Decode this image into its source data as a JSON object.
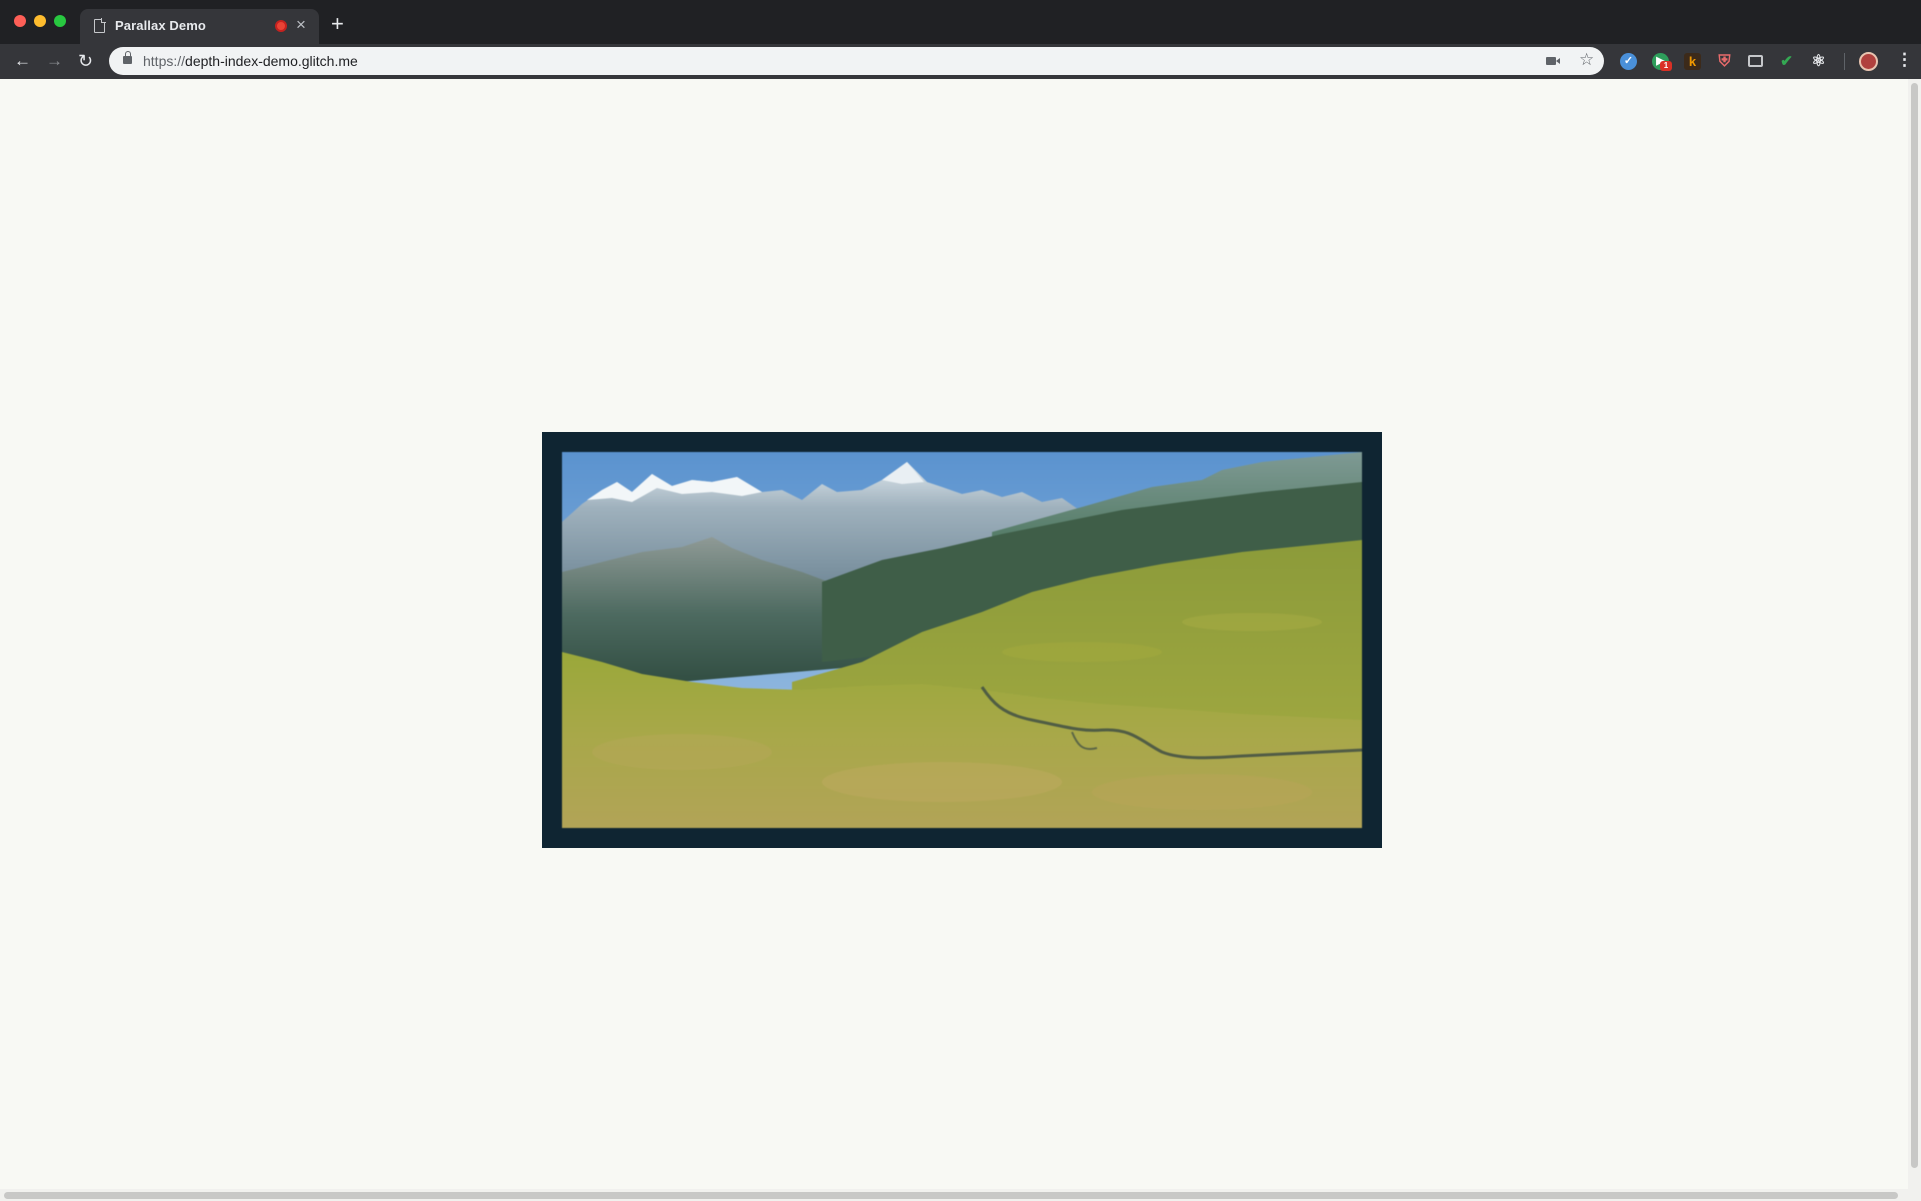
{
  "window": {
    "tab_title": "Parallax Demo",
    "tab_close_glyph": "×",
    "new_tab_glyph": "+"
  },
  "toolbar": {
    "back_glyph": "←",
    "forward_glyph": "→",
    "reload_glyph": "↻",
    "url_scheme": "https://",
    "url_host": "depth-index-demo.glitch.me",
    "star_glyph": "☆",
    "menu_glyph": "⋮",
    "extensions": [
      {
        "name": "extension-1-icon",
        "glyph": "✓"
      },
      {
        "name": "extension-2-icon",
        "glyph": "▶",
        "badge": "1"
      },
      {
        "name": "extension-3-icon",
        "glyph": "k"
      },
      {
        "name": "extension-4-icon",
        "glyph": "⛨"
      },
      {
        "name": "extension-5-icon",
        "glyph": ""
      },
      {
        "name": "extension-6-icon",
        "glyph": "✔"
      },
      {
        "name": "extension-7-icon",
        "glyph": "⚛"
      }
    ]
  },
  "page": {
    "image_alt": "Alpine mountain valley landscape",
    "colors": {
      "background": "#f8f9f4",
      "frame": "#0f2532",
      "sky": "#6fa3d4",
      "meadow": "#9aa83a"
    }
  }
}
